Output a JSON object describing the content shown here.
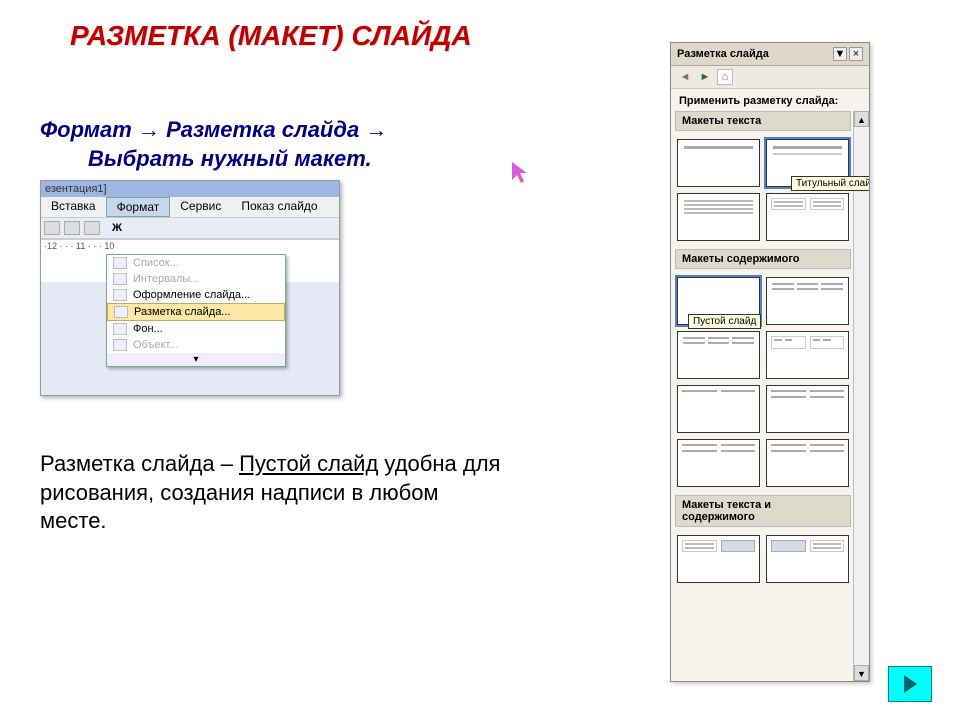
{
  "title": "РАЗМЕТКА (МАКЕТ) СЛАЙДА",
  "instruction": {
    "part1": "Формат",
    "arrow1": "→",
    "part2": "Разметка слайда",
    "arrow2": "→",
    "part3": "Выбрать нужный макет."
  },
  "body": {
    "t1": "Разметка слайда – ",
    "t2": "Пустой слайд",
    "t3": " удобна для рисования, создания надписи в любом месте."
  },
  "menu_shot": {
    "titlebar": "езентация1]",
    "menubar": {
      "m1": "Вставка",
      "m2": "Формат",
      "m3": "Сервис",
      "m4": "Показ слайдо"
    },
    "ruler": "·12 · · · 11 · · · 10",
    "toolbar_bold": "Ж",
    "dropdown": {
      "i1": "Список...",
      "i2": "Интервалы...",
      "i3": "Оформление слайда...",
      "i4": "Разметка слайда...",
      "i5": "Фон...",
      "i6": "Объект..."
    }
  },
  "pane": {
    "title": "Разметка слайда",
    "close": "×",
    "drop": "▼",
    "nav_back": "◄",
    "nav_fwd": "►",
    "nav_home": "⌂",
    "apply_label": "Применить разметку слайда:",
    "sections": {
      "text": "Макеты текста",
      "content": "Макеты содержимого",
      "textcontent": "Макеты текста и содержимого"
    },
    "tooltips": {
      "title_slide": "Титульный слайд",
      "blank_slide": "Пустой слайд"
    },
    "scroll_up": "▲",
    "scroll_down": "▼"
  }
}
